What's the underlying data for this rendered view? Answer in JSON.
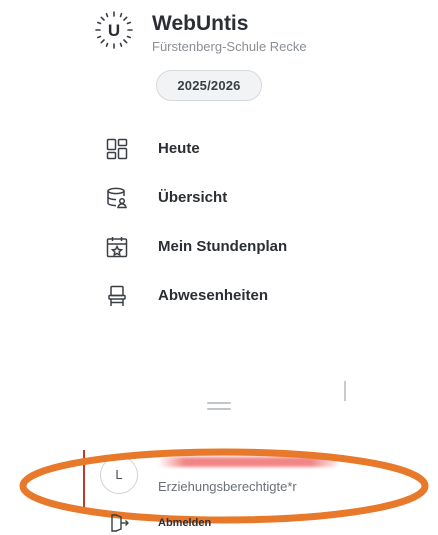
{
  "brand": {
    "logo_letter": "U",
    "title": "WebUntis",
    "subtitle": "Fürstenberg-Schule Recke"
  },
  "school_year": "2025/2026",
  "nav": {
    "items": [
      {
        "label": "Heute",
        "icon": "dashboard-icon"
      },
      {
        "label": "Übersicht",
        "icon": "overview-icon"
      },
      {
        "label": "Mein Stundenplan",
        "icon": "calendar-icon"
      },
      {
        "label": "Abwesenheiten",
        "icon": "chair-icon"
      }
    ]
  },
  "profile": {
    "avatar_initial": "L",
    "role": "Erziehungsberechtigte*r"
  },
  "logout": {
    "label": "Abmelden",
    "icon": "logout-icon"
  },
  "colors": {
    "annotation": "#e8782a",
    "accent_bar": "#c0392b",
    "text": "#2b2f33"
  }
}
